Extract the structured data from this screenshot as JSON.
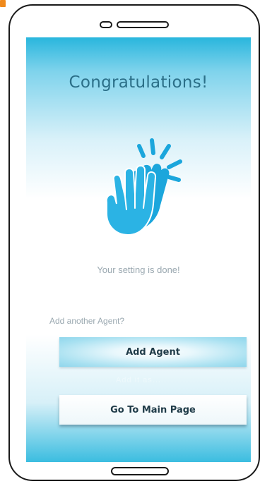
{
  "colors": {
    "accent": "#29b6dd",
    "title": "#2b6f88",
    "icon": "#1ba6dc",
    "corner_mark": "#f08a1c"
  },
  "screen": {
    "title": "Congratulations!",
    "icon": "clapping-hands-icon",
    "status": "Your setting is done!",
    "prompt": "Add another Agent?",
    "add_button_label": "Add Agent",
    "hint": "Add it as...",
    "main_button_label": "Go To Main Page"
  }
}
